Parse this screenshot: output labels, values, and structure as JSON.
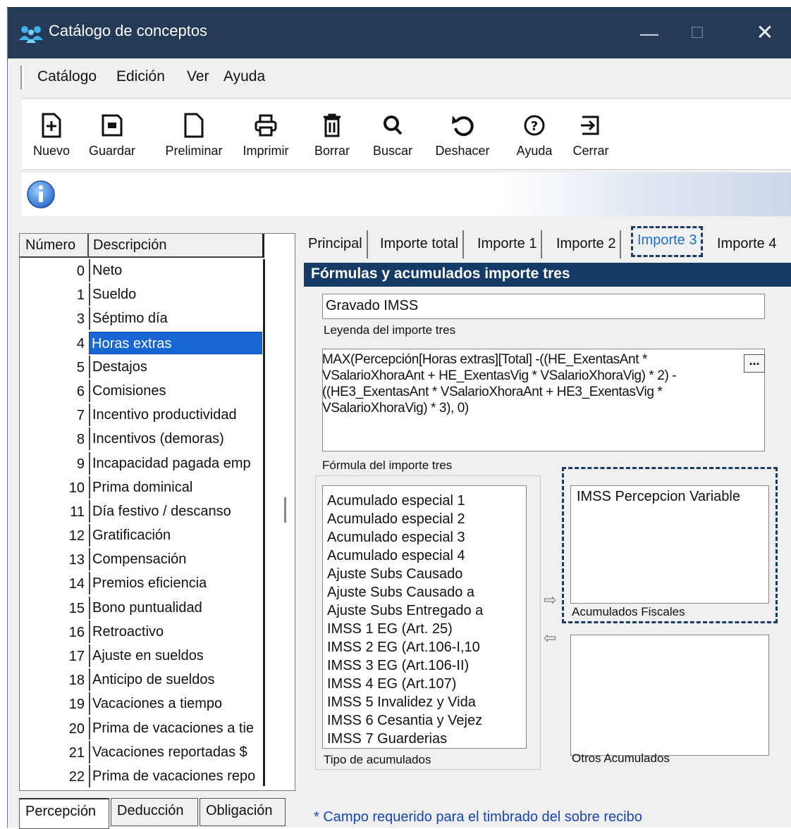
{
  "window": {
    "title": "Catálogo de conceptos"
  },
  "menu": {
    "items": [
      "Catálogo",
      "Edición",
      "Ver",
      "Ayuda"
    ]
  },
  "toolbar": {
    "buttons": [
      {
        "label": "Nuevo",
        "icon": "new-document-icon"
      },
      {
        "label": "Guardar",
        "icon": "save-icon"
      },
      {
        "label": "Preliminar",
        "icon": "preview-document-icon"
      },
      {
        "label": "Imprimir",
        "icon": "printer-icon"
      },
      {
        "label": "Borrar",
        "icon": "trash-icon"
      },
      {
        "label": "Buscar",
        "icon": "search-icon"
      },
      {
        "label": "Deshacer",
        "icon": "undo-icon"
      },
      {
        "label": "Ayuda",
        "icon": "help-icon"
      },
      {
        "label": "Cerrar",
        "icon": "exit-icon"
      }
    ]
  },
  "list": {
    "headers": {
      "number": "Número",
      "description": "Descripción"
    },
    "rows": [
      {
        "num": "0",
        "desc": "Neto"
      },
      {
        "num": "1",
        "desc": "Sueldo"
      },
      {
        "num": "3",
        "desc": "Séptimo día"
      },
      {
        "num": "4",
        "desc": "Horas extras",
        "selected": true
      },
      {
        "num": "5",
        "desc": "Destajos"
      },
      {
        "num": "6",
        "desc": "Comisiones"
      },
      {
        "num": "7",
        "desc": "Incentivo productividad"
      },
      {
        "num": "8",
        "desc": "Incentivos (demoras)"
      },
      {
        "num": "9",
        "desc": "Incapacidad pagada emp"
      },
      {
        "num": "10",
        "desc": "Prima dominical"
      },
      {
        "num": "11",
        "desc": "Día festivo / descanso"
      },
      {
        "num": "12",
        "desc": "Gratificación"
      },
      {
        "num": "13",
        "desc": "Compensación"
      },
      {
        "num": "14",
        "desc": "Premios eficiencia"
      },
      {
        "num": "15",
        "desc": "Bono puntualidad"
      },
      {
        "num": "16",
        "desc": "Retroactivo"
      },
      {
        "num": "17",
        "desc": "Ajuste en sueldos"
      },
      {
        "num": "18",
        "desc": "Anticipo de sueldos"
      },
      {
        "num": "19",
        "desc": "Vacaciones a tiempo"
      },
      {
        "num": "20",
        "desc": "Prima de vacaciones a tie"
      },
      {
        "num": "21",
        "desc": "Vacaciones reportadas $"
      },
      {
        "num": "22",
        "desc": "Prima de vacaciones repo"
      }
    ]
  },
  "bottom_tabs": [
    "Percepción",
    "Deducción",
    "Obligación"
  ],
  "tabs": [
    "Principal",
    "Importe total",
    "Importe 1",
    "Importe 2",
    "Importe 3",
    "Importe 4"
  ],
  "active_tab": "Importe 3",
  "section": {
    "title": "Fórmulas y acumulados importe tres",
    "legend_value": "Gravado IMSS",
    "legend_label": "Leyenda del importe tres",
    "formula_value": "MAX(Percepción[Horas extras][Total] -((HE_ExentasAnt * VSalarioXhoraAnt + HE_ExentasVig * VSalarioXhoraVig) * 2) - ((HE3_ExentasAnt * VSalarioXhoraAnt + HE3_ExentasVig * VSalarioXhoraVig) * 3), 0)",
    "formula_label": "Fórmula del importe tres",
    "formula_button": "...",
    "acc_types": [
      "Acumulado especial 1",
      "Acumulado especial 2",
      "Acumulado especial 3",
      "Acumulado especial 4",
      "Ajuste Subs Causado",
      "Ajuste Subs Causado a",
      "Ajuste Subs Entregado a",
      "IMSS 1 EG (Art. 25)",
      "IMSS 2 EG (Art.106-I,10",
      "IMSS 3 EG (Art.106-II)",
      "IMSS 4 EG (Art.107)",
      "IMSS 5 Invalidez y Vida",
      "IMSS 6 Cesantia y Vejez",
      "IMSS 7 Guarderias"
    ],
    "acc_types_label": "Tipo de acumulados",
    "fiscal_items": [
      "IMSS Percepcion Variable"
    ],
    "fiscal_label": "Acumulados Fiscales",
    "otros_label": "Otros Acumulados"
  },
  "footer_note": "* Campo requerido para el timbrado del sobre recibo",
  "colors": {
    "titlebar": "#243a56",
    "header": "#163a66",
    "selection": "#1866d4",
    "note": "#1744b8"
  }
}
